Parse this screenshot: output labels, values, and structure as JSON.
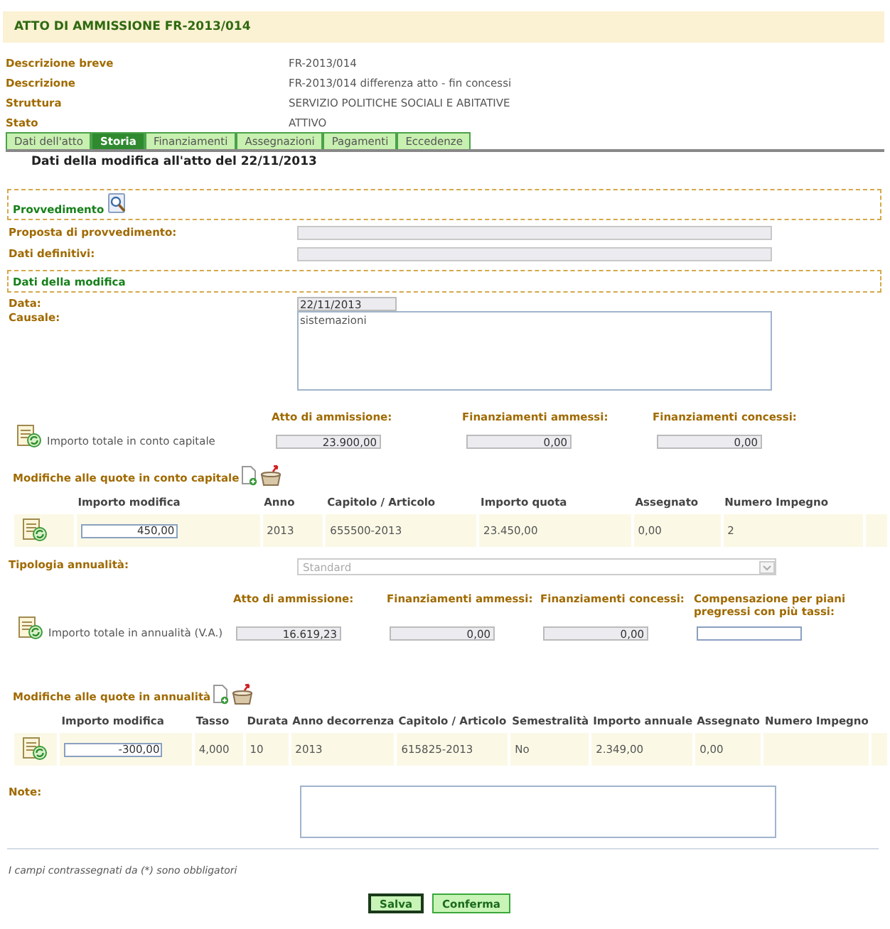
{
  "title": "ATTO DI AMMISSIONE FR-2013/014",
  "info": [
    {
      "label": "Descrizione breve",
      "value": "FR-2013/014"
    },
    {
      "label": "Descrizione",
      "value": "FR-2013/014 differenza atto - fin concessi"
    },
    {
      "label": "Struttura",
      "value": "SERVIZIO POLITICHE SOCIALI E ABITATIVE"
    },
    {
      "label": "Stato",
      "value": "ATTIVO"
    }
  ],
  "tabs": [
    {
      "label": "Dati dell'atto",
      "selected": false
    },
    {
      "label": "Storia",
      "selected": true
    },
    {
      "label": "Finanziamenti",
      "selected": false
    },
    {
      "label": "Assegnazioni",
      "selected": false
    },
    {
      "label": "Pagamenti",
      "selected": false
    },
    {
      "label": "Eccedenze",
      "selected": false
    }
  ],
  "subtitle": "Dati della modifica all'atto del 22/11/2013",
  "provvedimento": {
    "title": "Provvedimento",
    "fields": [
      {
        "label": "Proposta di provvedimento:"
      },
      {
        "label": "Dati definitivi:"
      }
    ]
  },
  "modifica": {
    "title": "Dati della modifica",
    "data": {
      "label": "Data:",
      "value": "22/11/2013"
    },
    "causale": {
      "label": "Causale:",
      "value": "sistemazioni"
    }
  },
  "capitale": {
    "total_label": "Importo totale in conto capitale",
    "totals": [
      {
        "heading": "Atto di ammissione:",
        "kind": "readonly",
        "value": "23.900,00"
      },
      {
        "heading": "Finanziamenti ammessi:",
        "kind": "readonly",
        "value": "0,00"
      },
      {
        "heading": "Finanziamenti concessi:",
        "kind": "readonly",
        "value": "0,00"
      }
    ],
    "quote_title": "Modifiche alle quote in conto capitale",
    "columns": [
      "Importo modifica",
      "Anno",
      "Capitolo / Articolo",
      "Importo quota",
      "Assegnato",
      "Numero Impegno"
    ],
    "rows": [
      {
        "cells": [
          "450,00",
          "2013",
          "655500-2013",
          "23.450,00",
          "0,00",
          "2"
        ]
      }
    ]
  },
  "tipologia": {
    "label": "Tipologia annualità:",
    "value": "Standard",
    "disabled": true
  },
  "annualita": {
    "total_label": "Importo totale in annualità (V.A.)",
    "totals": [
      {
        "heading": "Atto di ammissione:",
        "kind": "readonly",
        "value": "16.619,23"
      },
      {
        "heading": "Finanziamenti ammessi:",
        "kind": "readonly",
        "value": "0,00"
      },
      {
        "heading": "Finanziamenti concessi:",
        "kind": "readonly",
        "value": "0,00"
      },
      {
        "heading": "Compensazione per piani pregressi con più tassi:",
        "kind": "input"
      }
    ],
    "quote_title": "Modifiche alle quote in annualità",
    "columns": [
      "Importo modifica",
      "Tasso",
      "Durata",
      "Anno decorrenza",
      "Capitolo / Articolo",
      "Semestralità",
      "Importo annuale",
      "Assegnato",
      "Numero Impegno"
    ],
    "rows": [
      {
        "cells": [
          "-300,00",
          "4,000",
          "10",
          "2013",
          "615825-2013",
          "No",
          "2.349,00",
          "0,00"
        ]
      }
    ]
  },
  "note": {
    "label": "Note:"
  },
  "footnote": "I campi contrassegnati da (*) sono obbligatori",
  "buttons": [
    {
      "label": "Salva",
      "focused": true
    },
    {
      "label": "Conferma",
      "focused": false
    }
  ]
}
